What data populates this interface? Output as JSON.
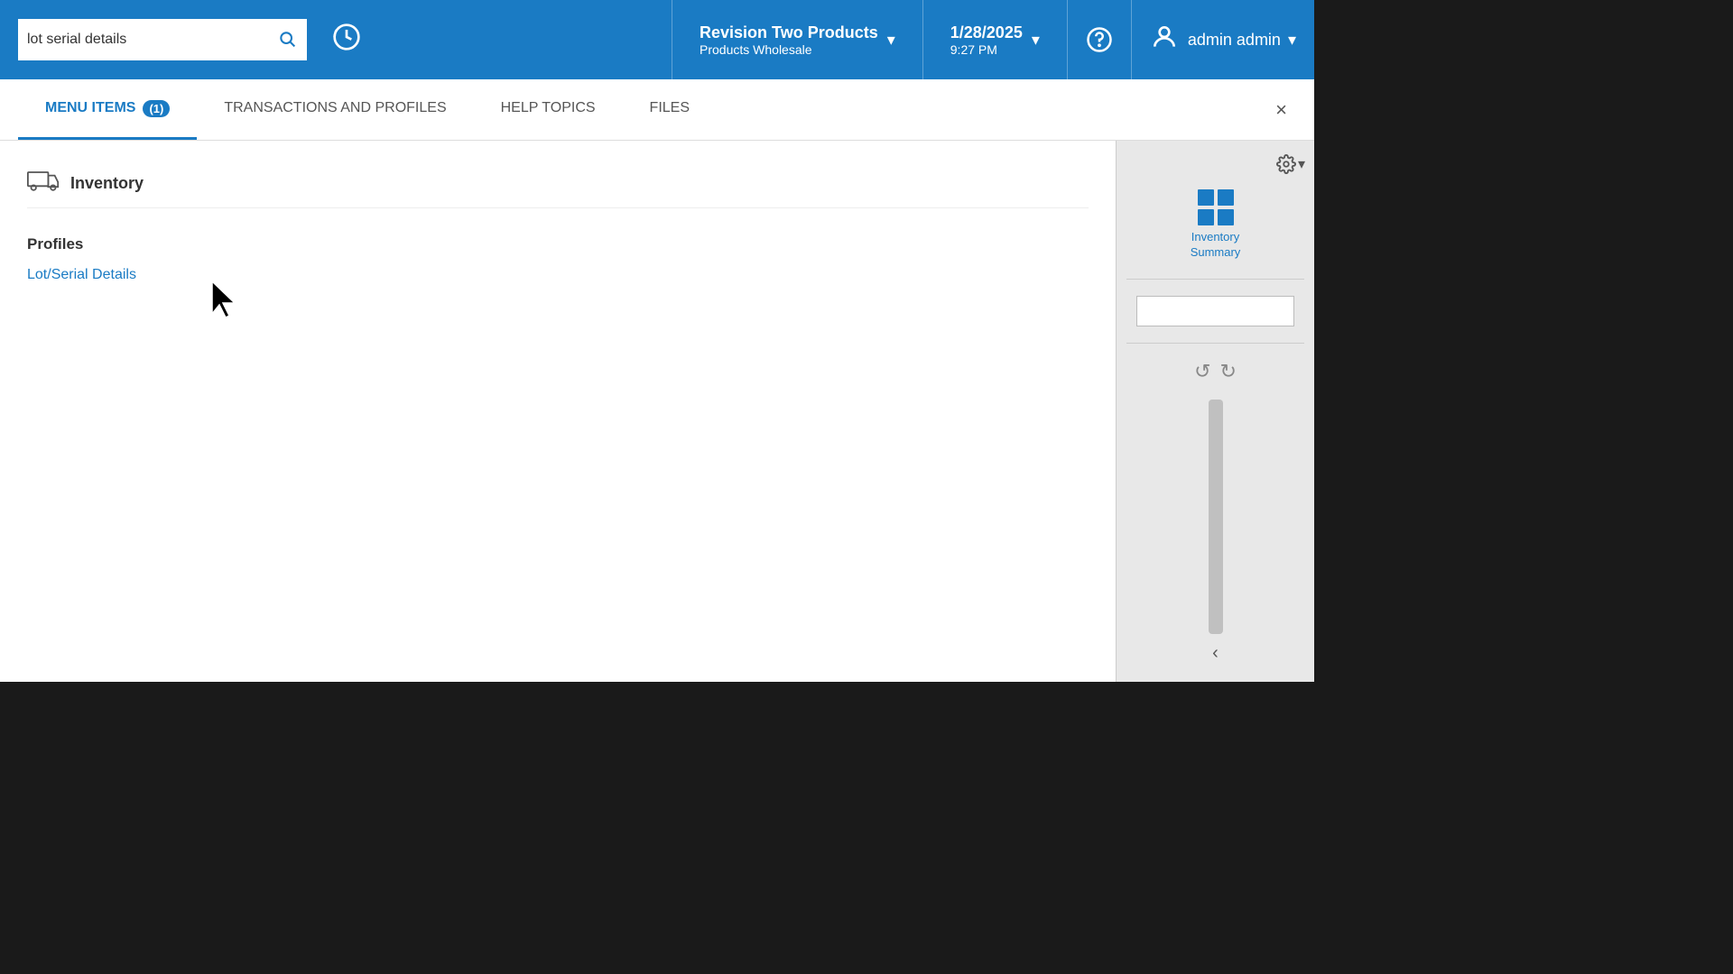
{
  "header": {
    "search_placeholder": "lot serial details",
    "history_icon": "↺",
    "company": {
      "name": "Revision Two Products",
      "sub": "Products Wholesale"
    },
    "datetime": {
      "date": "1/28/2025",
      "time": "9:27 PM"
    },
    "help_label": "?",
    "user": {
      "name": "admin admin"
    }
  },
  "tabs": {
    "menu_items": {
      "label": "MENU ITEMS",
      "badge": "(1)",
      "active": true
    },
    "transactions": {
      "label": "TRANSACTIONS AND PROFILES"
    },
    "help": {
      "label": "HELP TOPICS"
    },
    "files": {
      "label": "FILES"
    },
    "close_label": "×"
  },
  "results": {
    "category": {
      "icon": "🚚",
      "title": "Inventory"
    },
    "profiles": {
      "title": "Profiles",
      "items": [
        {
          "label": "Lot/Serial Details",
          "link": true
        }
      ]
    }
  },
  "sidebar": {
    "gear_icon": "⚙",
    "chevron_icon": "▾",
    "inventory_icon": "▦",
    "inventory_label": "Inventory\nSummary",
    "collapse_icon": "‹"
  }
}
